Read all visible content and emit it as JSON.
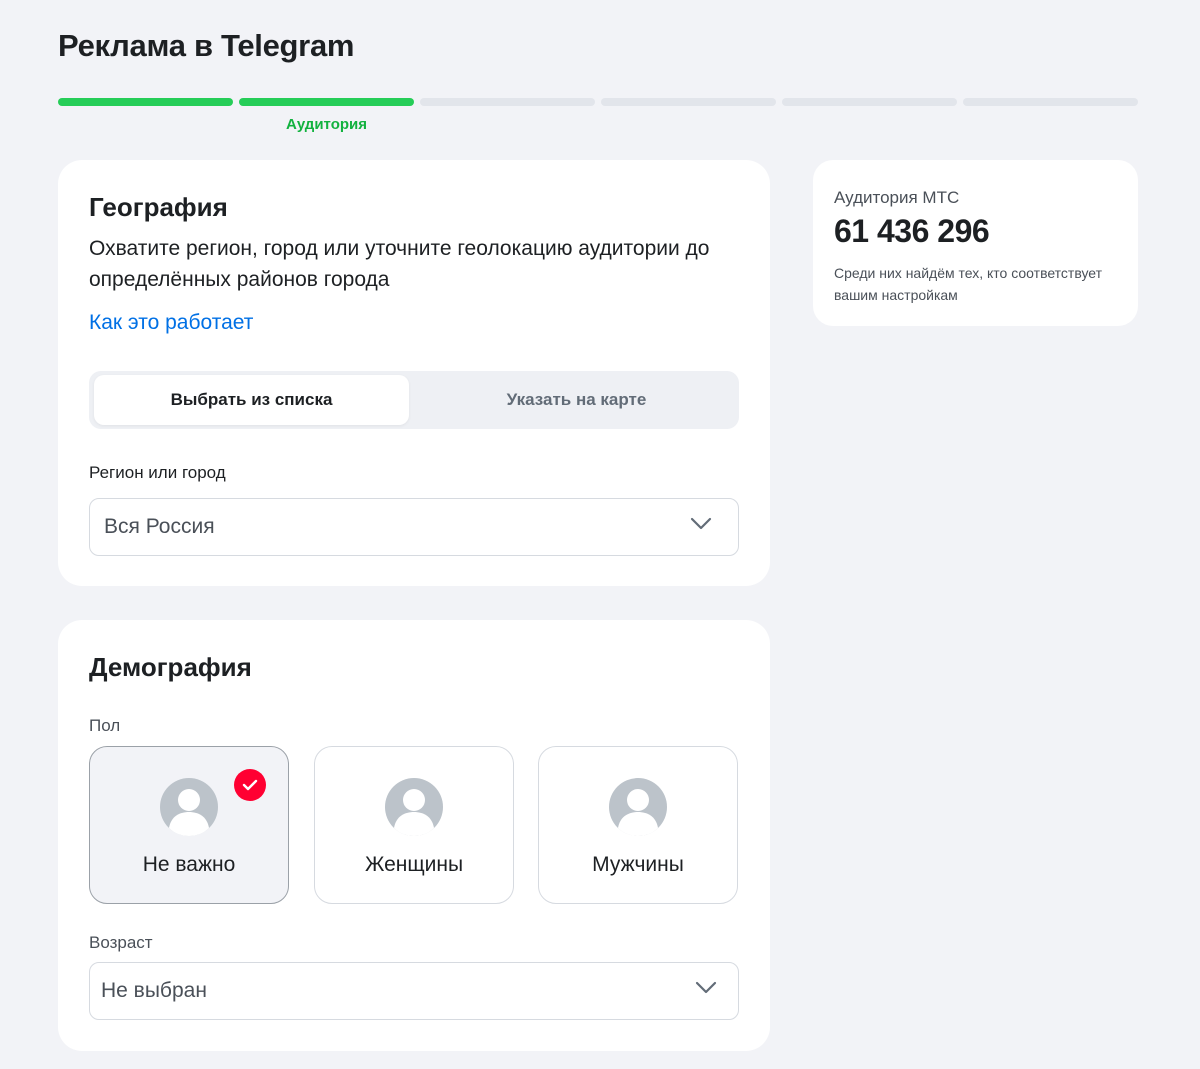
{
  "page": {
    "title": "Реклама в Telegram"
  },
  "stepper": {
    "steps": [
      {
        "state": "done",
        "label": ""
      },
      {
        "state": "done",
        "label": "Аудитория"
      },
      {
        "state": "todo",
        "label": ""
      },
      {
        "state": "todo",
        "label": ""
      },
      {
        "state": "todo",
        "label": ""
      },
      {
        "state": "todo",
        "label": ""
      }
    ],
    "current_label": "Аудитория"
  },
  "geography": {
    "title": "География",
    "description": "Охватите регион, город или уточните геолокацию аудитории до определённых районов города",
    "link": "Как это работает",
    "tabs": {
      "list": "Выбрать из списка",
      "map": "Указать на карте",
      "active": "list"
    },
    "region_label": "Регион или город",
    "region_value": "Вся Россия"
  },
  "demography": {
    "title": "Демография",
    "gender_label": "Пол",
    "gender_options": {
      "any": "Не важно",
      "female": "Женщины",
      "male": "Мужчины"
    },
    "gender_selected": "any",
    "age_label": "Возраст",
    "age_value": "Не выбран"
  },
  "audience": {
    "label": "Аудитория МТС",
    "count": "61 436 296",
    "note": "Среди них найдём тех, кто соответствует вашим настройкам"
  },
  "colors": {
    "accent_green": "#26cd58",
    "link_blue": "#0070e5",
    "check_red": "#ff0032",
    "background": "#f2f3f7"
  },
  "icons": {
    "chevron": "chevron-down-icon",
    "avatar": "user-avatar-icon",
    "check": "check-icon"
  }
}
